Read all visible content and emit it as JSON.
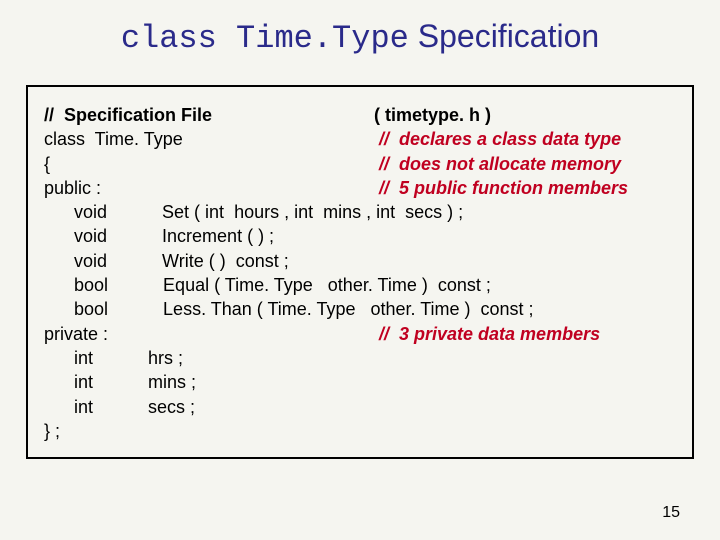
{
  "title": {
    "code_part": "class Time.Type",
    "spec_part": " Specification"
  },
  "code": {
    "l1_left": "//  Specification File",
    "l1_right": "( timetype. h )",
    "l2_left": "class  Time. Type",
    "l2_right": "//  declares a class data type",
    "l3_left": "{",
    "l3_right": "//  does not allocate memory",
    "l4_left": "public :",
    "l4_right": "//  5 public function members",
    "m1": "      void           Set ( int  hours , int  mins , int  secs ) ;",
    "m2": "      void           Increment ( ) ;",
    "m3": "      void           Write ( )  const ;",
    "m4": "      bool           Equal ( Time. Type   other. Time )  const ;",
    "m5": "      bool           Less. Than ( Time. Type   other. Time )  const ;",
    "l5_left": "private :",
    "l5_right": "//  3 private data members",
    "d1": "      int           hrs ;",
    "d2": "      int           mins ;",
    "d3": "      int           secs ;",
    "lend": "} ;"
  },
  "page_number": "15"
}
